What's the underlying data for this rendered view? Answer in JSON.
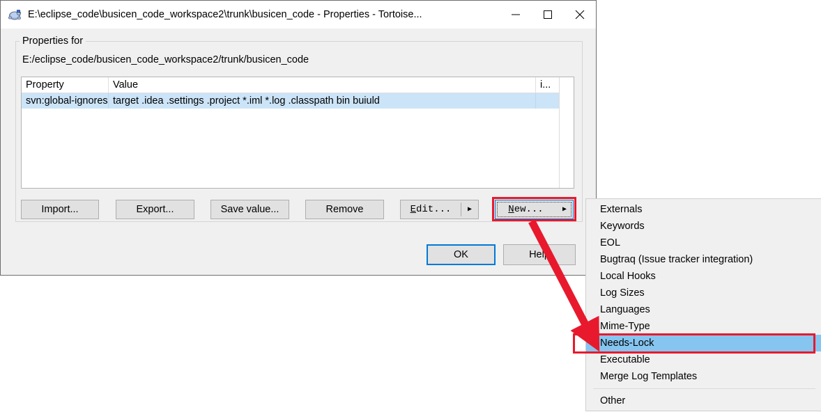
{
  "window": {
    "title": "E:\\eclipse_code\\busicen_code_workspace2\\trunk\\busicen_code - Properties - Tortoise...",
    "icon": "tortoise-svn-icon",
    "minimize_label": "minimize-icon",
    "maximize_label": "maximize-icon",
    "close_label": "close-icon"
  },
  "group": {
    "legend": "Properties for",
    "path": "E:/eclipse_code/busicen_code_workspace2/trunk/busicen_code"
  },
  "table": {
    "columns": [
      "Property",
      "Value",
      "i..."
    ],
    "rows": [
      {
        "property": "svn:global-ignores",
        "value": "target .idea .settings .project *.iml *.log .classpath bin buiuld",
        "info": ""
      }
    ]
  },
  "buttons": {
    "import": "Import...",
    "export": "Export...",
    "save_value": "Save value...",
    "remove": "Remove",
    "edit": "Edit...",
    "edit_mnemonic": "E",
    "edit_rest": "dit...",
    "new": "New...",
    "new_mnemonic": "N",
    "new_rest": "ew...",
    "dropdown_arrow": "▶",
    "ok": "OK",
    "help": "Help"
  },
  "menu": {
    "items": [
      {
        "label": "Externals",
        "selected": false
      },
      {
        "label": "Keywords",
        "selected": false
      },
      {
        "label": "EOL",
        "selected": false
      },
      {
        "label": "Bugtraq (Issue tracker integration)",
        "selected": false
      },
      {
        "label": "Local Hooks",
        "selected": false
      },
      {
        "label": "Log Sizes",
        "selected": false
      },
      {
        "label": "Languages",
        "selected": false
      },
      {
        "label": "Mime-Type",
        "selected": false
      },
      {
        "label": "Needs-Lock",
        "selected": true
      },
      {
        "label": "Executable",
        "selected": false
      },
      {
        "label": "Merge Log Templates",
        "selected": false
      }
    ],
    "after_separator": [
      {
        "label": "Other",
        "selected": false
      }
    ]
  },
  "annotations": {
    "highlight_color": "#e8192c",
    "arrow_color": "#e8192c",
    "selection_color": "#86c5f0",
    "accent_color": "#0078d7"
  }
}
